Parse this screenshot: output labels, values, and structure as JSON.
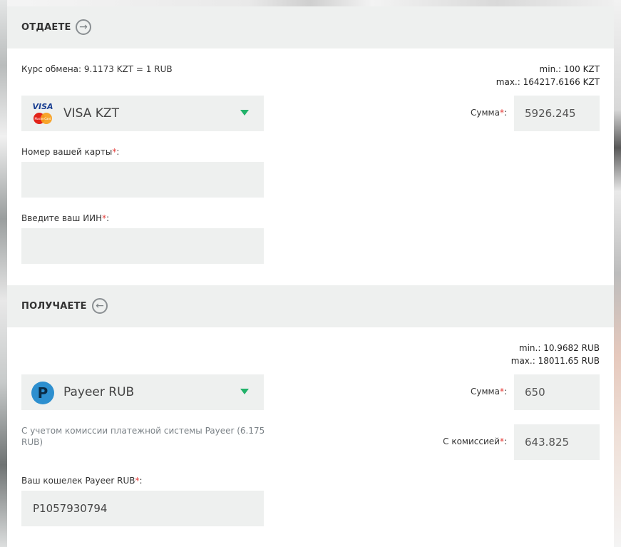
{
  "give": {
    "title": "ОТДАЕТЕ",
    "rate": "Курс обмена: 9.1173 KZT = 1 RUB",
    "min": "min.: 100 KZT",
    "max": "max.: 164217.6166 KZT",
    "currency": {
      "label": "VISA KZT",
      "logo_top": "VISA",
      "logo_bottom": "MasterCard"
    },
    "amount_label": "Сумма",
    "amount_value": "5926.245",
    "card_field_label": "Номер вашей карты",
    "card_field_value": "",
    "iin_field_label": "Введите ваш ИИН",
    "iin_field_value": ""
  },
  "receive": {
    "title": "ПОЛУЧАЕТЕ",
    "min": "min.: 10.9682 RUB",
    "max": "max.: 18011.65 RUB",
    "currency": {
      "label": "Payeer RUB",
      "logo_letter": "P"
    },
    "amount_label": "Сумма",
    "amount_value": "650",
    "fee_note": "С учетом комиссии платежной системы Payeer (6.175 RUB)",
    "with_fee_label": "С комиссией",
    "with_fee_value": "643.825",
    "wallet_label": "Ваш кошелек Payeer RUB",
    "wallet_value": "P1057930794"
  },
  "required_mark": "*",
  "colors": {
    "accent_caret": "#22b26a",
    "required": "#e53935",
    "field_bg": "#eef0ef"
  }
}
